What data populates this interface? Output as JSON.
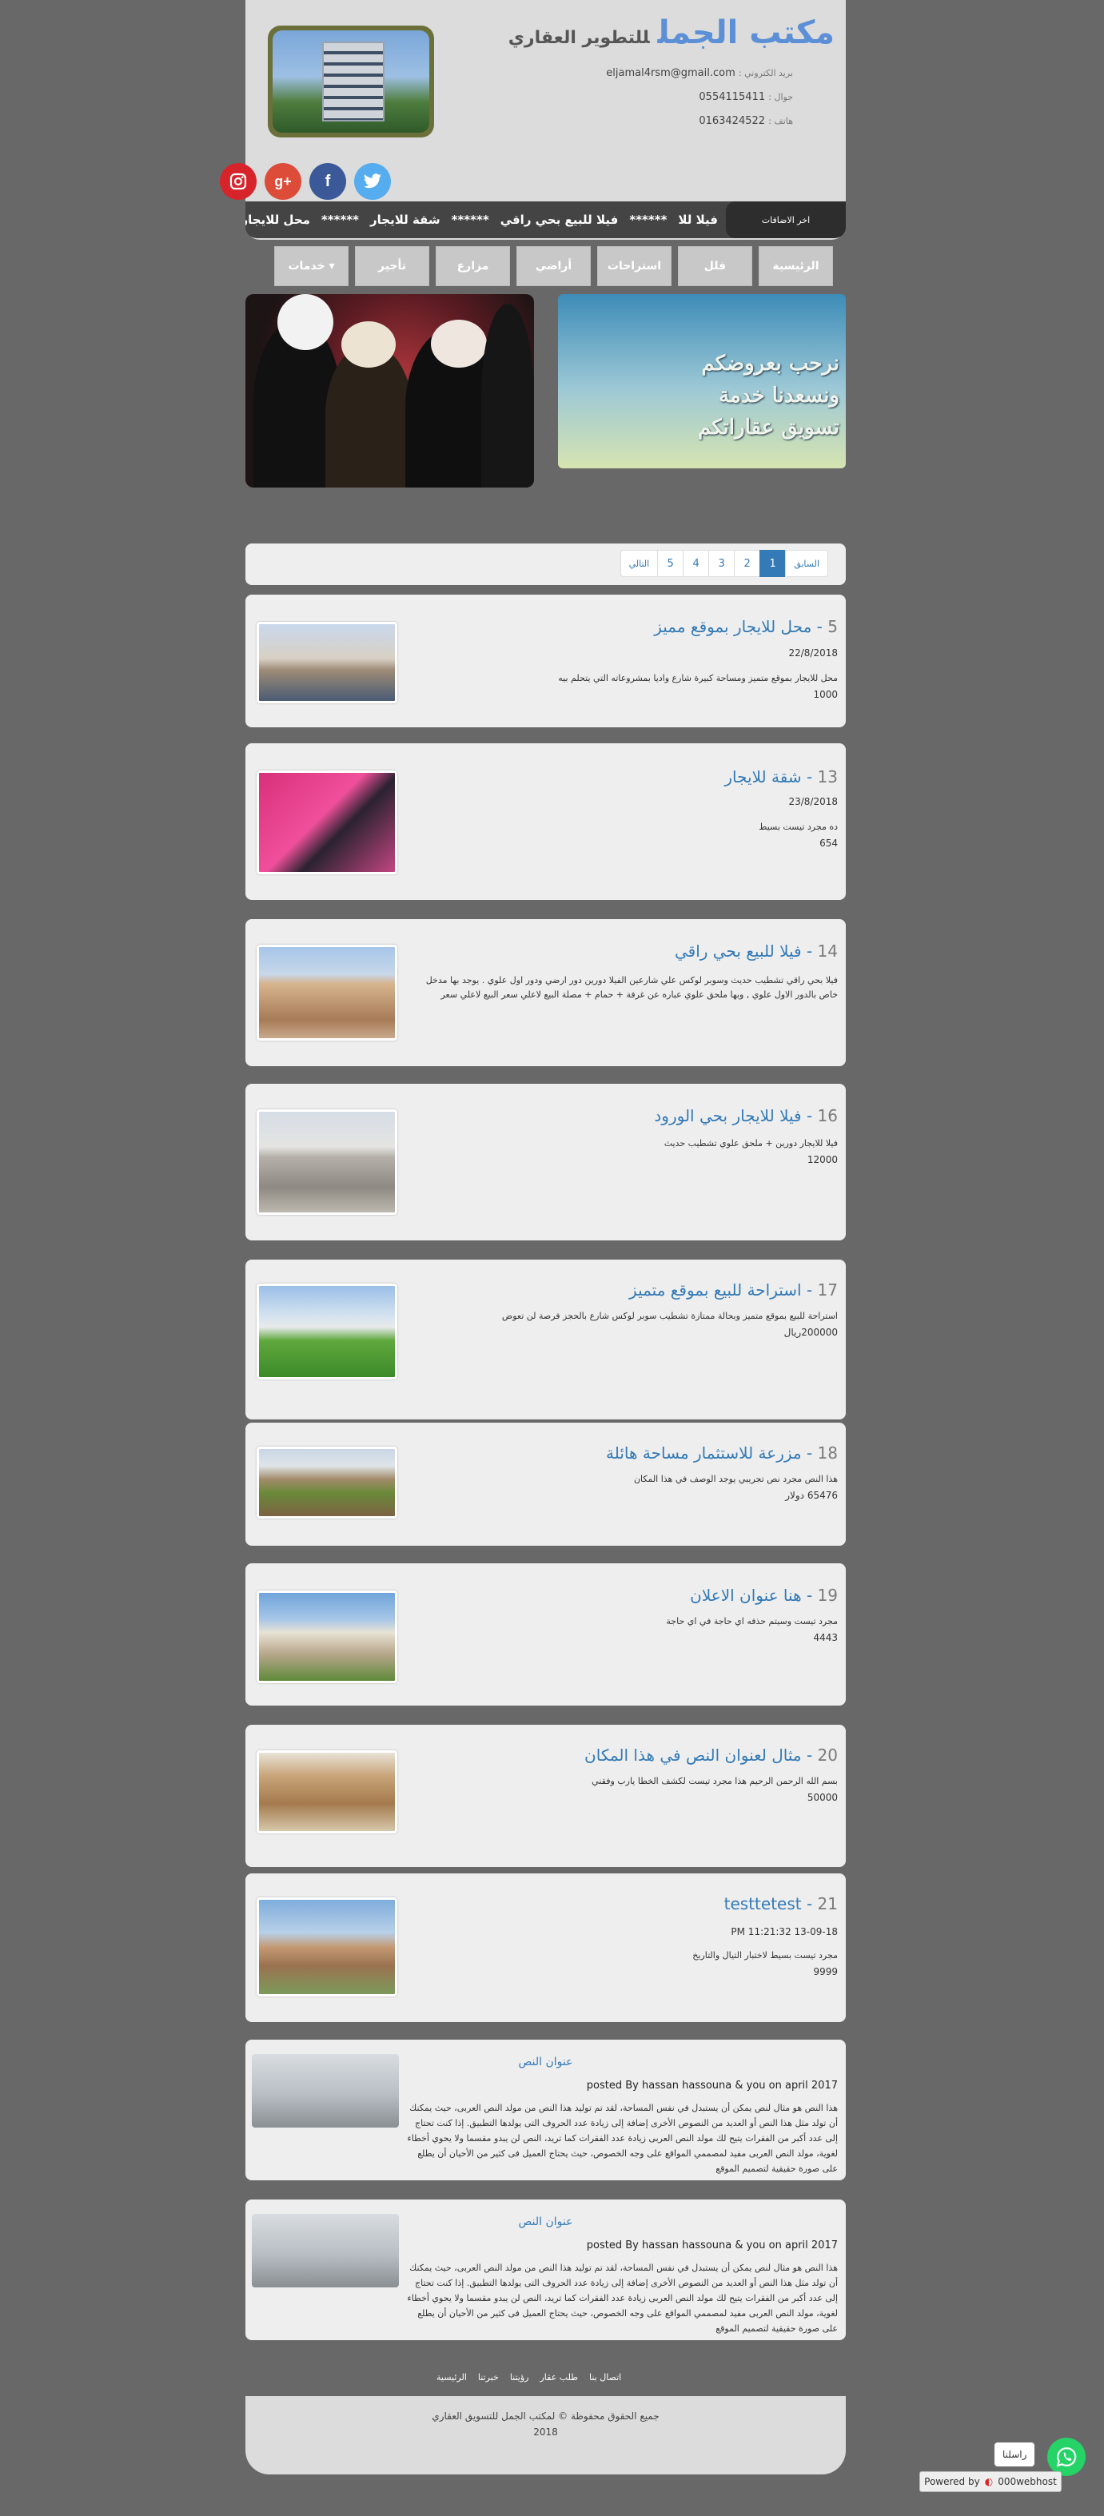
{
  "header": {
    "brand_big": "مكتب الجمل",
    "brand_small": "للتطوير العقاري",
    "email_label": "بريد الكتروني :",
    "email": "eljamal4rsm@gmail.com",
    "mobile_label": "جوال :",
    "mobile": "0554115411",
    "phone_label": "هاتف :",
    "phone": "0163424522"
  },
  "socials": [
    {
      "name": "instagram-icon",
      "glyph": "◎",
      "color": "#d6242a"
    },
    {
      "name": "google-plus-icon",
      "glyph": "g+",
      "color": "#dd4b39"
    },
    {
      "name": "facebook-icon",
      "glyph": "f",
      "color": "#3b5998"
    },
    {
      "name": "twitter-icon",
      "glyph": "t",
      "color": "#55acee"
    }
  ],
  "ticker": {
    "label": "اخر الاضافات",
    "items": [
      "محل للايجار بموقع مميز",
      "******",
      "شقة للايجار",
      "******",
      "فيلا للبيع بحي راقي",
      "******",
      "فيلا للا"
    ]
  },
  "nav": [
    "الرئيسية",
    "فلل",
    "استراحات",
    "أراضي",
    "مزارع",
    "تأجير",
    "خدمات ▾"
  ],
  "banner": {
    "line1": "نرحب بعروضكم",
    "line2": "ونسعدنا خدمة",
    "line3": "تسويق عقاراتكم"
  },
  "pagination": {
    "prev": "السابق",
    "pages": [
      "1",
      "2",
      "3",
      "4",
      "5"
    ],
    "next": "التالي",
    "active": "1"
  },
  "listings": [
    {
      "num": "5",
      "title": "محل للايجار بموقع مميز",
      "date": "22/8/2018",
      "desc": "محل للايجار بموقع متميز ومساحة كبيرة شارع واديا بمشروعاته التي يتحلم بيه",
      "price": "1000"
    },
    {
      "num": "13",
      "title": "شقة للايجار",
      "date": "23/8/2018",
      "desc": "ده مجرد تيست بسيط",
      "price": "654"
    },
    {
      "num": "14",
      "title": "فيلا للبيع بحي راقي",
      "date": "",
      "desc": "فيلا بحي راقي تشطيب حديث وسوبر لوكس علي شارعين الفيلا دورين دور ارضي ودور اول علوي . يوجد بها مدخل خاص بالدور الاول علوي , وبها ملحق علوي عباره عن غرفة + حمام + مصلة البيع لاعلي سعر البيع لاعلي سعر",
      "price": ""
    },
    {
      "num": "16",
      "title": "فيلا للايجار بحي الورود",
      "date": "",
      "desc": "فيلا للايجار دورين + ملحق علوي تشطيب حديث",
      "price": "12000"
    },
    {
      "num": "17",
      "title": "استراحة للبيع بموقع متميز",
      "date": "",
      "desc": "استراحة للبيع بموقع متميز وبحالة ممتازة تشطيب سوبر لوكس شارع بالحجز فرصة لن تعوض",
      "price": "200000ريال"
    },
    {
      "num": "18",
      "title": "مزرعة للاستثمار مساحة هائلة",
      "date": "",
      "desc": "هذا النص مجرد نص تجريبي يوجد الوصف في هذا المكان",
      "price": "65476 دولار"
    },
    {
      "num": "19",
      "title": "هنا عنوان الاعلان",
      "date": "",
      "desc": "مجرد تيست وسيتم حذفه اي حاجة في اي حاجة",
      "price": "4443"
    },
    {
      "num": "20",
      "title": "مثال لعنوان النص في هذا المكان",
      "date": "",
      "desc": "بسم الله الرحمن الرحيم هذا مجرد تيست لكشف الخطا يارب وفقني",
      "price": "50000"
    },
    {
      "num": "21",
      "title": "testtetest",
      "date": "PM 11:21:32 13-09-18",
      "desc": "مجرد تيست بسيط لاختبار التيال والتاريخ",
      "price": "9999"
    }
  ],
  "posts": [
    {
      "title": "عنوان النص",
      "by": "posted By hassan hassouna & you on april 2017",
      "body": "هذا النص هو مثال لنص يمكن أن يستبدل في نفس المساحة، لقد تم توليد هذا النص من مولد النص العربى، حيث يمكنك أن تولد مثل هذا النص أو العديد من النصوص الأخرى إضافة إلى زيادة عدد الحروف التى يولدها التطبيق. إذا كنت تحتاج إلى عدد أكبر من الفقرات يتيح لك مولد النص العربى زيادة عدد الفقرات كما تريد، النص لن يبدو مقسما ولا يحوي أخطاء لغوية، مولد النص العربى مفيد لمصممي المواقع على وجه الخصوص، حيث يحتاج العميل فى كثير من الأحيان أن يطلع على صورة حقيقية لتصميم الموقع"
    },
    {
      "title": "عنوان النص",
      "by": "posted By hassan hassouna & you on april 2017",
      "body": "هذا النص هو مثال لنص يمكن أن يستبدل في نفس المساحة، لقد تم توليد هذا النص من مولد النص العربى، حيث يمكنك أن تولد مثل هذا النص أو العديد من النصوص الأخرى إضافة إلى زيادة عدد الحروف التى يولدها التطبيق. إذا كنت تحتاج إلى عدد أكبر من الفقرات يتيح لك مولد النص العربى زيادة عدد الفقرات كما تريد، النص لن يبدو مقسما ولا يحوي أخطاء لغوية، مولد النص العربى مفيد لمصممي المواقع على وجه الخصوص، حيث يحتاج العميل فى كثير من الأحيان أن يطلع على صورة حقيقية لتصميم الموقع"
    }
  ],
  "footer": {
    "links": [
      "الرئيسية",
      "خبرتنا",
      "رؤيتنا",
      "طلب عقار",
      "اتصال بنا"
    ],
    "copyright": "جميع الحقوق محفوظة © لمكتب الجمل للتسويق العقاري",
    "year": "2018"
  },
  "whatsapp": {
    "tip": "راسلنا"
  },
  "powered": {
    "label": "Powered by",
    "brand": "000webhost"
  }
}
